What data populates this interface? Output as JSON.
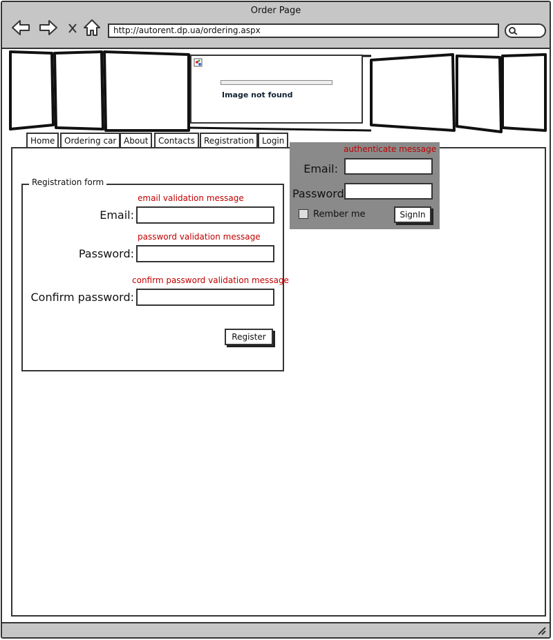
{
  "window": {
    "title": "Order Page"
  },
  "browser": {
    "url": "http://autorent.dp.ua/ordering.aspx"
  },
  "banner": {
    "image_alt": "Image not found"
  },
  "nav": {
    "tabs": [
      "Home",
      "Ordering car",
      "About",
      "Contacts",
      "Registration",
      "Login"
    ]
  },
  "registration": {
    "legend": "Registration form",
    "email_label": "Email:",
    "email_validation": "email validation message",
    "password_label": "Password:",
    "password_validation": "password validation message",
    "confirm_label": "Confirm password:",
    "confirm_validation": "confirm password validation message",
    "register_button": "Register"
  },
  "login": {
    "message": "authenticate message",
    "email_label": "Email:",
    "password_label": "Password:",
    "remember_label": "Rember me",
    "signin_button": "SignIn"
  },
  "colors": {
    "validation": "#c00000",
    "panel": "#8a8a8a",
    "chrome": "#c6c6c6"
  }
}
